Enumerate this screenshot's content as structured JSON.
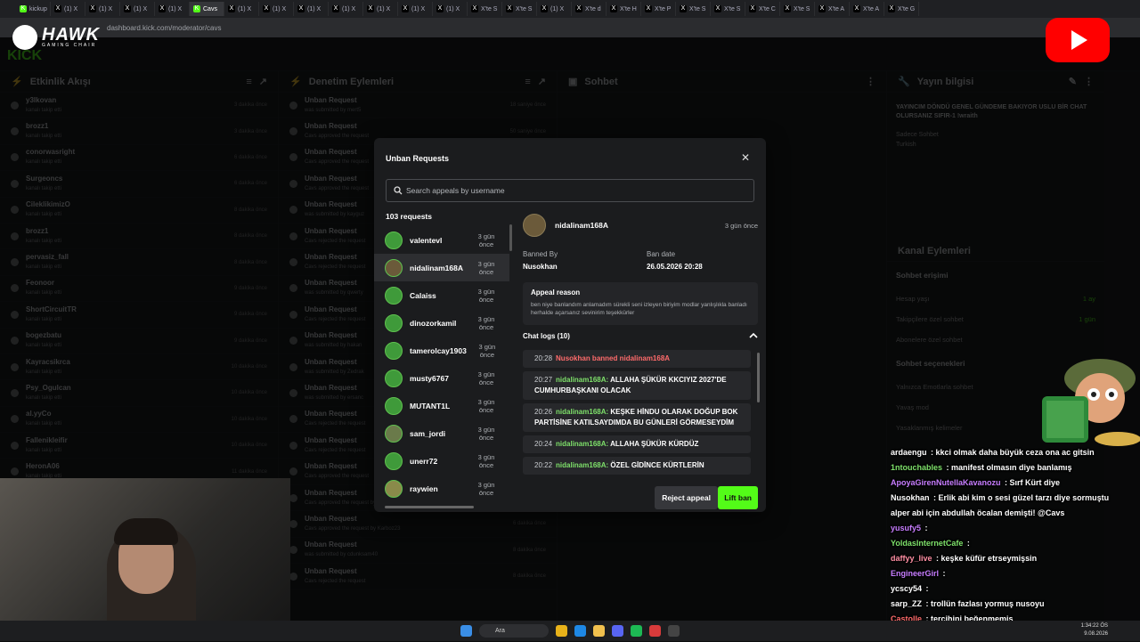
{
  "browser": {
    "tabs": [
      {
        "label": "kickup",
        "fav": "K",
        "color": "#53fc18"
      },
      {
        "label": "(1) X",
        "fav": "X",
        "color": "#000000"
      },
      {
        "label": "(1) X",
        "fav": "X",
        "color": "#000000"
      },
      {
        "label": "(1) X",
        "fav": "X",
        "color": "#000000"
      },
      {
        "label": "(1) X",
        "fav": "X",
        "color": "#000000"
      },
      {
        "label": "Cavs",
        "fav": "K",
        "color": "#53fc18",
        "active": true
      },
      {
        "label": "(1) X",
        "fav": "X",
        "color": "#000000"
      },
      {
        "label": "(1) X",
        "fav": "X",
        "color": "#000000"
      },
      {
        "label": "(1) X",
        "fav": "X",
        "color": "#000000"
      },
      {
        "label": "(1) X",
        "fav": "X",
        "color": "#000000"
      },
      {
        "label": "(1) X",
        "fav": "X",
        "color": "#000000"
      },
      {
        "label": "(1) X",
        "fav": "X",
        "color": "#000000"
      },
      {
        "label": "(1) X",
        "fav": "X",
        "color": "#000000"
      },
      {
        "label": "X'te S",
        "fav": "X",
        "color": "#000000"
      },
      {
        "label": "X'te S",
        "fav": "X",
        "color": "#000000"
      },
      {
        "label": "(1) X",
        "fav": "X",
        "color": "#000000"
      },
      {
        "label": "X'te d",
        "fav": "X",
        "color": "#000000"
      },
      {
        "label": "X'te H",
        "fav": "X",
        "color": "#000000"
      },
      {
        "label": "X'te P",
        "fav": "X",
        "color": "#000000"
      },
      {
        "label": "X'te S",
        "fav": "X",
        "color": "#000000"
      },
      {
        "label": "X'te S",
        "fav": "X",
        "color": "#000000"
      },
      {
        "label": "X'te C",
        "fav": "X",
        "color": "#000000"
      },
      {
        "label": "X'te S",
        "fav": "X",
        "color": "#000000"
      },
      {
        "label": "X'te A",
        "fav": "X",
        "color": "#000000"
      },
      {
        "label": "X'te A",
        "fav": "X",
        "color": "#000000"
      },
      {
        "label": "X'te G",
        "fav": "X",
        "color": "#000000"
      }
    ],
    "url": "dashboard.kick.com/moderator/cavs"
  },
  "logo": {
    "name": "HAWK",
    "tagline": "GAMING CHAIR"
  },
  "left_panels": {
    "activity": {
      "title": "Etkinlik Akışı",
      "items": [
        {
          "name": "y3lkovan",
          "sub": "kanalı takip etti",
          "time": "3 dakika önce"
        },
        {
          "name": "brozz1",
          "sub": "kanalı takip etti",
          "time": "3 dakika önce"
        },
        {
          "name": "conorwasright",
          "sub": "kanalı takip etti",
          "time": "6 dakika önce"
        },
        {
          "name": "Surgeoncs",
          "sub": "kanalı takip etti",
          "time": "6 dakika önce"
        },
        {
          "name": "CileklikimizO",
          "sub": "kanalı takip etti",
          "time": "8 dakika önce"
        },
        {
          "name": "brozz1",
          "sub": "kanalı takip etti",
          "time": "8 dakika önce"
        },
        {
          "name": "pervasiz_fall",
          "sub": "kanalı takip etti",
          "time": "8 dakika önce"
        },
        {
          "name": "Feonoor",
          "sub": "kanalı takip etti",
          "time": "9 dakika önce"
        },
        {
          "name": "ShortCircuitTR",
          "sub": "kanalı takip etti",
          "time": "9 dakika önce"
        },
        {
          "name": "bogezbatu",
          "sub": "kanalı takip etti",
          "time": "9 dakika önce"
        },
        {
          "name": "Kayracsikrca",
          "sub": "kanalı takip etti",
          "time": "10 dakika önce"
        },
        {
          "name": "Psy_Ogulcan",
          "sub": "kanalı takip etti",
          "time": "10 dakika önce"
        },
        {
          "name": "al.yyCo",
          "sub": "kanalı takip etti",
          "time": "10 dakika önce"
        },
        {
          "name": "Fallenikleifir",
          "sub": "kanalı takip etti",
          "time": "10 dakika önce"
        },
        {
          "name": "HeronA06",
          "sub": "kanalı takip etti",
          "time": "11 dakika önce"
        }
      ]
    },
    "moderation": {
      "title": "Denetim Eylemleri",
      "items": [
        {
          "name": "Unban Request",
          "sub": "was submitted by mert5",
          "time": "18 saniye önce"
        },
        {
          "name": "Unban Request",
          "sub": "Cavs approved the request",
          "time": "50 saniye önce"
        },
        {
          "name": "Unban Request",
          "sub": "Cavs approved the request",
          "time": "2 dakika önce"
        },
        {
          "name": "Unban Request",
          "sub": "Cavs approved the request",
          "time": "2 dakika önce"
        },
        {
          "name": "Unban Request",
          "sub": "was submitted by kayguz",
          "time": "3 dakika önce"
        },
        {
          "name": "Unban Request",
          "sub": "Cavs rejected the request",
          "time": "3 dakika önce"
        },
        {
          "name": "Unban Request",
          "sub": "Cavs rejected the request",
          "time": "3 dakika önce"
        },
        {
          "name": "Unban Request",
          "sub": "was submitted by qwerty",
          "time": "4 dakika önce"
        },
        {
          "name": "Unban Request",
          "sub": "Cavs rejected the request",
          "time": "4 dakika önce"
        },
        {
          "name": "Unban Request",
          "sub": "was submitted by hakan",
          "time": "4 dakika önce"
        },
        {
          "name": "Unban Request",
          "sub": "was submitted by Zedrak",
          "time": "5 dakika önce"
        },
        {
          "name": "Unban Request",
          "sub": "was submitted by ersanc",
          "time": "5 dakika önce"
        },
        {
          "name": "Unban Request",
          "sub": "Cavs rejected the request",
          "time": "5 dakika önce"
        },
        {
          "name": "Unban Request",
          "sub": "Cavs rejected the request",
          "time": "6 dakika önce"
        },
        {
          "name": "Unban Request",
          "sub": "Cavs approved the request",
          "time": "6 dakika önce"
        },
        {
          "name": "Unban Request",
          "sub": "Cavs approved the request by brimisinahra",
          "time": "6 dakika önce"
        },
        {
          "name": "Unban Request",
          "sub": "Cavs approved the request by Karboz23",
          "time": "6 dakika önce"
        },
        {
          "name": "Unban Request",
          "sub": "was submitted by cdunksam40",
          "time": "8 dakika önce"
        },
        {
          "name": "Unban Request",
          "sub": "Cavs rejected the request",
          "time": "8 dakika önce"
        }
      ]
    },
    "chat": {
      "title": "Sohbet"
    },
    "stream_info": {
      "title": "Yayın bilgisi",
      "stream_title": "YAYINCIM DÖNDÜ GENEL GÜNDEME BAKIYOR USLU BİR CHAT OLURSANIZ SIFIR-1 !wraith",
      "category": "Sadece Sohbet",
      "language": "Turkish"
    },
    "channel_actions": {
      "title": "Kanal Eylemleri",
      "chat_access": "Sohbet erişimi",
      "rows": [
        {
          "label": "Hesap yaşı",
          "value": "1 ay"
        },
        {
          "label": "Takipçilere özel sohbet",
          "value": "1 gün"
        },
        {
          "label": "Abonelere özel sohbet",
          "value": ""
        }
      ],
      "options_title": "Sohbet seçenekleri",
      "options": [
        "Yalnızca Emotlarla sohbet",
        "Yavaş mod",
        "Yasaklanmış kelimeler"
      ]
    }
  },
  "modal": {
    "title": "Unban Requests",
    "search_placeholder": "Search appeals by username",
    "count_label": "103 requests",
    "requests": [
      {
        "name": "valentevl",
        "time": "3 gün önce",
        "color": "#3f9a3a"
      },
      {
        "name": "nidalinam168A",
        "time": "3 gün önce",
        "color": "#6b5a3a",
        "selected": true
      },
      {
        "name": "Calaiss",
        "time": "3 gün önce",
        "color": "#3f9a3a"
      },
      {
        "name": "dinozorkamil",
        "time": "3 gün önce",
        "color": "#3f9a3a"
      },
      {
        "name": "tamerolcay1903",
        "time": "3 gün önce",
        "color": "#3f9a3a"
      },
      {
        "name": "musty6767",
        "time": "3 gün önce",
        "color": "#3f9a3a"
      },
      {
        "name": "MUTANT1L",
        "time": "3 gün önce",
        "color": "#3f9a3a"
      },
      {
        "name": "sam_jordi",
        "time": "3 gün önce",
        "color": "#6a7a4a"
      },
      {
        "name": "unerr72",
        "time": "3 gün önce",
        "color": "#3f9a3a"
      },
      {
        "name": "raywien",
        "time": "3 gün önce",
        "color": "#8a8a4a"
      },
      {
        "name": "",
        "time": "3",
        "color": "#3f9a3a"
      }
    ],
    "detail": {
      "username": "nidalinam168A",
      "time": "3 gün önce",
      "banned_by_label": "Banned By",
      "banned_by": "Nusokhan",
      "ban_date_label": "Ban date",
      "ban_date": "26.05.2026 20:28",
      "appeal_title": "Appeal reason",
      "appeal_text": "ben niye banlandım anlamadım sürekli seni izleyen biriyim modlar yanlışlıkla banladı herhalde açarsanız sevinirim teşekkürler",
      "logs_title": "Chat logs (10)",
      "logs": [
        {
          "time": "20:28",
          "user": "",
          "text": "Nusokhan banned nidalinam168A",
          "ban": true
        },
        {
          "time": "20:27",
          "user": "nidalinam168A:",
          "text": "ALLAHA ŞÜKÜR KKCIYIZ 2027'DE CUMHURBAŞKANI OLACAK"
        },
        {
          "time": "20:26",
          "user": "nidalinam168A:",
          "text": "KEŞKE HİNDU OLARAK DOĞUP BOK PARTİSİNE KATILSAYDIMDA BU GÜNLERİ GÖRMESEYDİM"
        },
        {
          "time": "20:24",
          "user": "nidalinam168A:",
          "text": "ALLAHA ŞÜKÜR KÜRDÜZ"
        },
        {
          "time": "20:22",
          "user": "nidalinam168A:",
          "text": "ÖZEL GİDİNCE KÜRTLERİN"
        }
      ],
      "reject_label": "Reject appeal",
      "lift_label": "Lift ban"
    }
  },
  "overlay_chat": [
    {
      "user": "ardaengu",
      "color": "#ffffff",
      "text": "kkci olmak daha büyük ceza ona ac gitsin"
    },
    {
      "user": "1ntouchables",
      "color": "#7ee06a",
      "text": "manifest olmasın diye banlamış"
    },
    {
      "user": "ApoyaGirenNutellaKavanozu",
      "color": "#c77dff",
      "text": "Sırf Kürt diye"
    },
    {
      "user": "Nusokhan",
      "color": "#ffffff",
      "text": "Erlik abi kim o sesi güzel tarzı diye sormuştu"
    },
    {
      "user": "",
      "color": "#ffffff",
      "text": "alper abi için abdullah öcalan demişti! @Cavs"
    },
    {
      "user": "yusufy5",
      "color": "#c77dff",
      "text": ""
    },
    {
      "user": "YoldasInternetCafe",
      "color": "#7ee06a",
      "text": ""
    },
    {
      "user": "daffyy_live",
      "color": "#ff8fa3",
      "text": "keşke küfür etrseymişsin"
    },
    {
      "user": "EngineerGirl",
      "color": "#c77dff",
      "text": ""
    },
    {
      "user": "ycscy54",
      "color": "#ffffff",
      "text": ""
    },
    {
      "user": "sarp_ZZ",
      "color": "#ffffff",
      "text": "trollün fazlası yormuş nusoyu"
    },
    {
      "user": "Castolle",
      "color": "#ff6b6b",
      "text": "tercihini beğenmemiş"
    },
    {
      "user": "ACILIPORSUK",
      "color": "#8ab4ff",
      "text": "özgür özelci nusakan"
    }
  ],
  "taskbar": {
    "search": "Ara",
    "time": "1:34:22 ÖS",
    "date": "9.08.2026"
  }
}
